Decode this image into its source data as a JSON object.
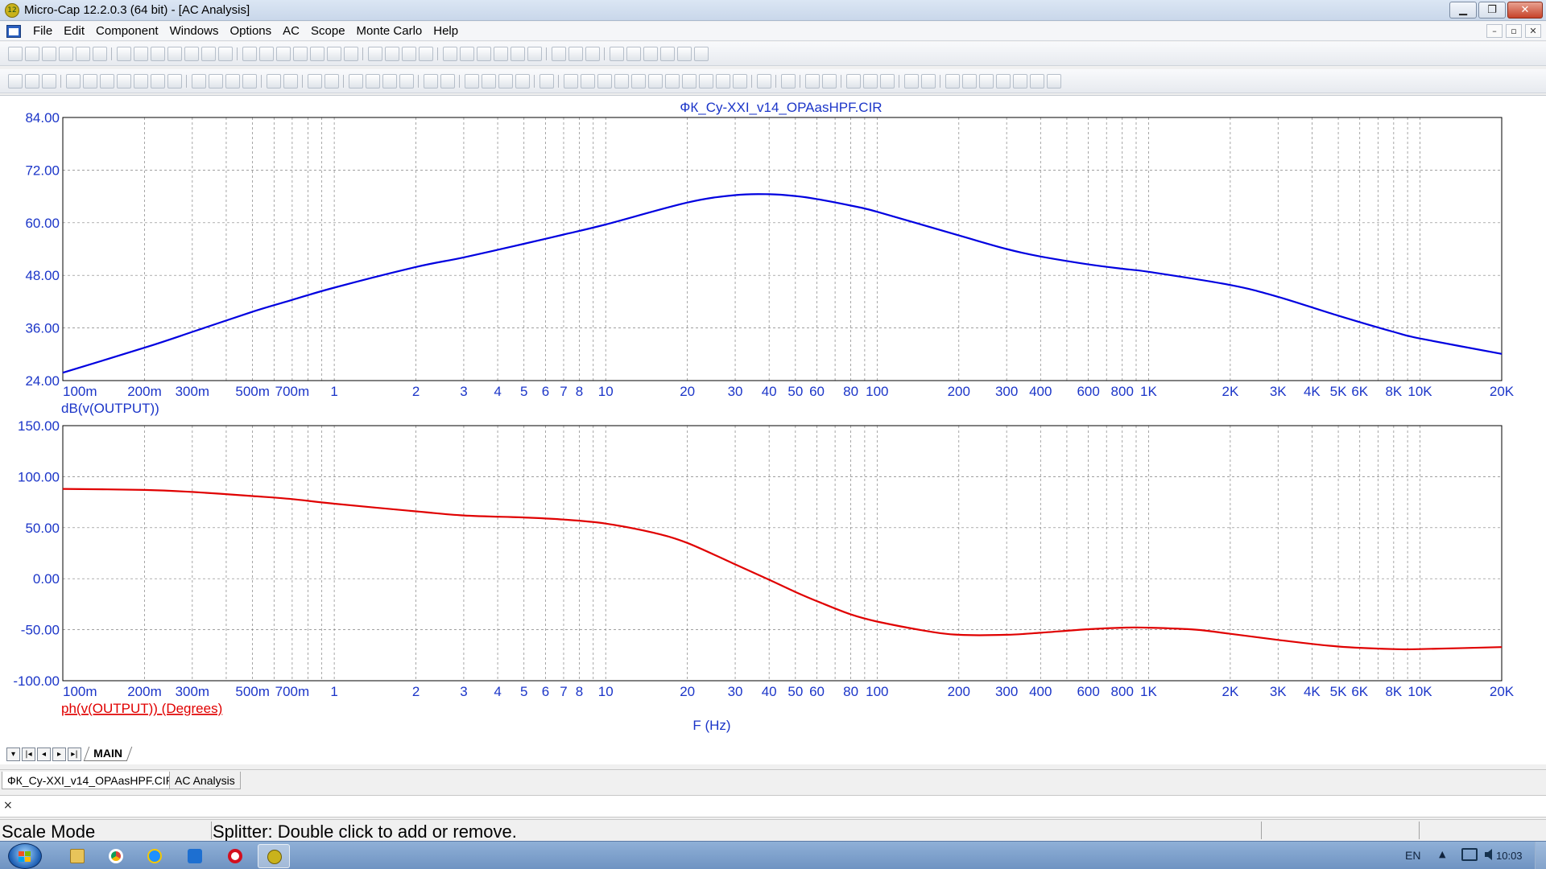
{
  "window": {
    "title": "Micro-Cap 12.2.0.3 (64 bit) - [AC Analysis]",
    "app_icon_text": "12",
    "buttons": {
      "minimize": "▁",
      "maximize": "❐",
      "close": "✕"
    }
  },
  "menu": {
    "items": [
      "File",
      "Edit",
      "Component",
      "Windows",
      "Options",
      "AC",
      "Scope",
      "Monte Carlo",
      "Help"
    ],
    "mdi": [
      "–",
      "▫",
      "✕"
    ]
  },
  "toolbar1": {
    "icons": [
      "new-icon",
      "open-icon",
      "save-icon",
      "save-all-icon",
      "print-preview-icon",
      "print-icon",
      "|",
      "undo-icon",
      "redo-icon",
      "cut-icon",
      "copy-icon",
      "paste-icon",
      "delete-icon",
      "select-all-icon",
      "|",
      "ground-icon",
      "resistor-icon",
      "capacitor-icon",
      "inductor-icon",
      "diode-icon",
      "battery-icon",
      "transistor-icon",
      "|",
      "opamp-icon",
      "probe-icon",
      "switch-icon",
      "source-icon",
      "|",
      "window-cascade-icon",
      "tile-h-icon",
      "tile-v-icon",
      "split-icon",
      "window-icon",
      "calc-icon",
      "|",
      "component-icon",
      "library-icon",
      "globe-icon",
      "|",
      "properties-icon",
      "list-icon",
      "grid-icon",
      "options-icon",
      "chart-icon",
      "check-icon"
    ]
  },
  "toolbar2": {
    "icons": [
      "pointer-icon",
      "record-icon",
      "step-icon",
      "|",
      "window1-icon",
      "window2-icon",
      "window3-icon",
      "window4-icon",
      "window5-icon",
      "window6-icon",
      "text-icon",
      "|",
      "image-icon",
      "run-icon",
      "pause-icon",
      "stop-icon",
      "|",
      "scale-icon",
      "cursor-icon",
      "|",
      "box1-icon",
      "box2-icon",
      "|",
      "layout1-icon",
      "layout2-icon",
      "layout3-icon",
      "layout4-icon",
      "|",
      "grid1-icon",
      "grid2-icon",
      "|",
      "zoom1-icon",
      "zoom2-icon",
      "zoom3-icon",
      "zoom4-icon",
      "|",
      "edit-icon",
      "|",
      "peak-icon",
      "valley-icon",
      "high-icon",
      "low-icon",
      "slope-icon",
      "level-icon",
      "inflection-icon",
      "global-high-icon",
      "global-low-icon",
      "top-icon",
      "bottom-icon",
      "|",
      "tag-icon",
      "|",
      "text-box-icon",
      "|",
      "fit-icon",
      "cursor-mode-icon",
      "|",
      "zoom-in-icon",
      "zoom-out-icon",
      "pan-icon",
      "|",
      "color-icon",
      "font-icon",
      "|",
      "align1-icon",
      "align2-icon",
      "align3-icon",
      "align4-icon",
      "align5-icon",
      "align6-icon",
      "align7-icon"
    ]
  },
  "chart_data": [
    {
      "type": "line",
      "title": "ФК_Cy-XXI_v14_OPAasHPF.CIR",
      "xscale": "log",
      "xlim": [
        0.1,
        20000
      ],
      "ylim": [
        24,
        84
      ],
      "yticks": [
        "84.00",
        "72.00",
        "60.00",
        "48.00",
        "36.00",
        "24.00"
      ],
      "xticks": [
        {
          "v": 0.1,
          "label": "100m"
        },
        {
          "v": 0.2,
          "label": "200m"
        },
        {
          "v": 0.3,
          "label": "300m"
        },
        {
          "v": 0.5,
          "label": "500m"
        },
        {
          "v": 0.7,
          "label": "700m"
        },
        {
          "v": 1,
          "label": "1"
        },
        {
          "v": 2,
          "label": "2"
        },
        {
          "v": 3,
          "label": "3"
        },
        {
          "v": 4,
          "label": "4"
        },
        {
          "v": 5,
          "label": "5"
        },
        {
          "v": 6,
          "label": "6"
        },
        {
          "v": 7,
          "label": "7"
        },
        {
          "v": 8,
          "label": "8"
        },
        {
          "v": 10,
          "label": "10"
        },
        {
          "v": 20,
          "label": "20"
        },
        {
          "v": 30,
          "label": "30"
        },
        {
          "v": 40,
          "label": "40"
        },
        {
          "v": 50,
          "label": "50"
        },
        {
          "v": 60,
          "label": "60"
        },
        {
          "v": 80,
          "label": "80"
        },
        {
          "v": 100,
          "label": "100"
        },
        {
          "v": 200,
          "label": "200"
        },
        {
          "v": 300,
          "label": "300"
        },
        {
          "v": 400,
          "label": "400"
        },
        {
          "v": 600,
          "label": "600"
        },
        {
          "v": 800,
          "label": "800"
        },
        {
          "v": 1000,
          "label": "1K"
        },
        {
          "v": 2000,
          "label": "2K"
        },
        {
          "v": 3000,
          "label": "3K"
        },
        {
          "v": 4000,
          "label": "4K"
        },
        {
          "v": 5000,
          "label": "5K"
        },
        {
          "v": 6000,
          "label": "6K"
        },
        {
          "v": 8000,
          "label": "8K"
        },
        {
          "v": 10000,
          "label": "10K"
        },
        {
          "v": 20000,
          "label": "20K"
        }
      ],
      "grid": true,
      "series": [
        {
          "name": "dB(v(OUTPUT))",
          "color": "#0000e0",
          "x": [
            0.1,
            0.2,
            0.3,
            0.5,
            0.7,
            1,
            2,
            3,
            5,
            7,
            10,
            20,
            30,
            40,
            50,
            60,
            80,
            100,
            200,
            300,
            400,
            600,
            800,
            1000,
            2000,
            3000,
            5000,
            8000,
            10000,
            20000
          ],
          "y": [
            25.8,
            31.5,
            35.1,
            39.7,
            42.4,
            45.2,
            49.9,
            52.1,
            55.2,
            57.3,
            59.6,
            64.6,
            66.3,
            66.5,
            66.1,
            65.4,
            63.9,
            62.5,
            57.1,
            54.0,
            52.3,
            50.5,
            49.5,
            48.8,
            45.8,
            43.1,
            38.8,
            35.1,
            33.6,
            30.1
          ]
        }
      ]
    },
    {
      "type": "line",
      "xscale": "log",
      "xlim": [
        0.1,
        20000
      ],
      "ylim": [
        -100,
        150
      ],
      "yticks": [
        "150.00",
        "100.00",
        "50.00",
        "0.00",
        "-50.00",
        "-100.00"
      ],
      "xlabel": "F (Hz)",
      "grid": true,
      "series": [
        {
          "name": "ph(v(OUTPUT)) (Degrees)",
          "color": "#e00000",
          "x": [
            0.1,
            0.2,
            0.3,
            0.5,
            0.7,
            1,
            2,
            3,
            5,
            7,
            10,
            15,
            20,
            30,
            40,
            50,
            60,
            80,
            100,
            150,
            200,
            300,
            400,
            600,
            800,
            1000,
            1500,
            2000,
            3000,
            5000,
            8000,
            10000,
            20000
          ],
          "y": [
            88,
            87,
            85,
            81,
            78,
            73.5,
            66,
            62,
            60,
            58,
            54,
            45,
            35,
            14,
            -1,
            -13,
            -22,
            -35,
            -42,
            -51,
            -55,
            -55,
            -53,
            -49.5,
            -48,
            -48,
            -50,
            -54,
            -60,
            -66.5,
            -69,
            -69,
            -67
          ]
        }
      ]
    }
  ],
  "plot_labels": {
    "trace_top": "dB(v(OUTPUT))",
    "trace_bottom": "ph(v(OUTPUT)) (Degrees)",
    "xlabel": "F (Hz)"
  },
  "page_tabs": {
    "nav": [
      "▾",
      "|◂",
      "◂",
      "▸",
      "▸|"
    ],
    "active": "MAIN"
  },
  "doc_tabs": [
    "ФК_Cy-XXI_v14_OPAasHPF.CIR",
    "AC Analysis"
  ],
  "output": {
    "close": "×"
  },
  "status": {
    "mode": "Scale Mode",
    "message": "Splitter: Double click to add or remove."
  },
  "taskbar": {
    "lang": "EN",
    "tray_arrow": "▲",
    "time": "10:03"
  },
  "colors": {
    "axis_text": "#1b35c8",
    "trace_db": "#0000e0",
    "trace_phase": "#e00000",
    "grid": "#808080"
  }
}
